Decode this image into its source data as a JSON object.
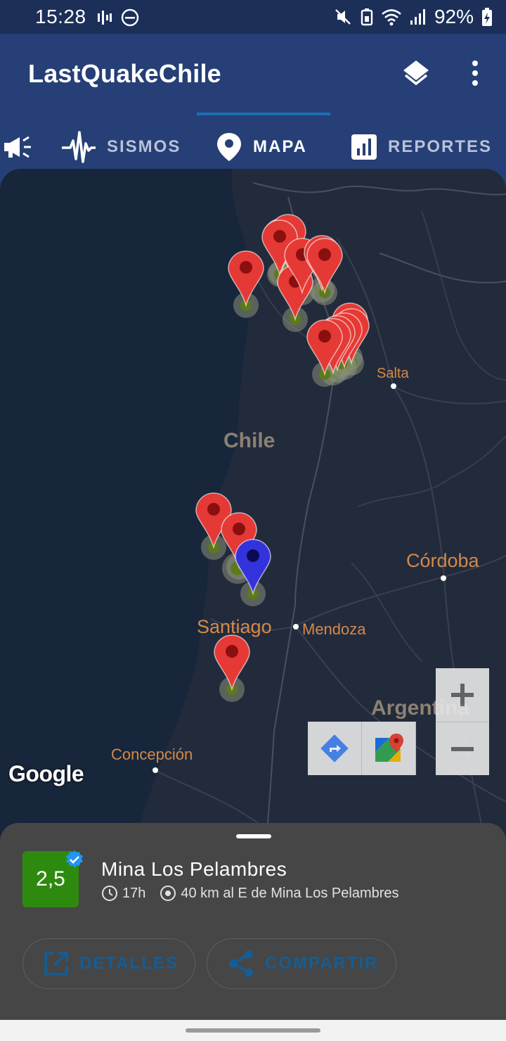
{
  "status_bar": {
    "time": "15:28",
    "battery": "92%"
  },
  "app_bar": {
    "title": "LastQuakeChile"
  },
  "tabs": [
    {
      "label": "SISMOS",
      "icon": "seismograph-icon",
      "selected": false
    },
    {
      "label": "MAPA",
      "icon": "map-pin-icon",
      "selected": true
    },
    {
      "label": "REPORTES",
      "icon": "bar-chart-icon",
      "selected": false
    }
  ],
  "map": {
    "labels": {
      "chile": "Chile",
      "salta": "Salta",
      "cordoba": "Córdoba",
      "santiago": "Santiago",
      "mendoza": "Mendoza",
      "argentina": "Argentina",
      "concepcion": "Concepción"
    },
    "attribution": "Google",
    "zoom_in": "+",
    "zoom_out": "−",
    "markers_red_count": 17,
    "markers_blue_count": 1
  },
  "selected_quake": {
    "magnitude": "2,5",
    "verified": true,
    "title": "Mina Los Pelambres",
    "time_ago": "17h",
    "reference": "40 km al E de Mina Los Pelambres",
    "details_label": "DETALLES",
    "share_label": "COMPARTIR"
  },
  "colors": {
    "primary": "#263f76",
    "accent": "#155d94",
    "magnitude_badge": "#2e8a0f",
    "marker_red": "#e53935",
    "marker_blue": "#3333dd"
  }
}
